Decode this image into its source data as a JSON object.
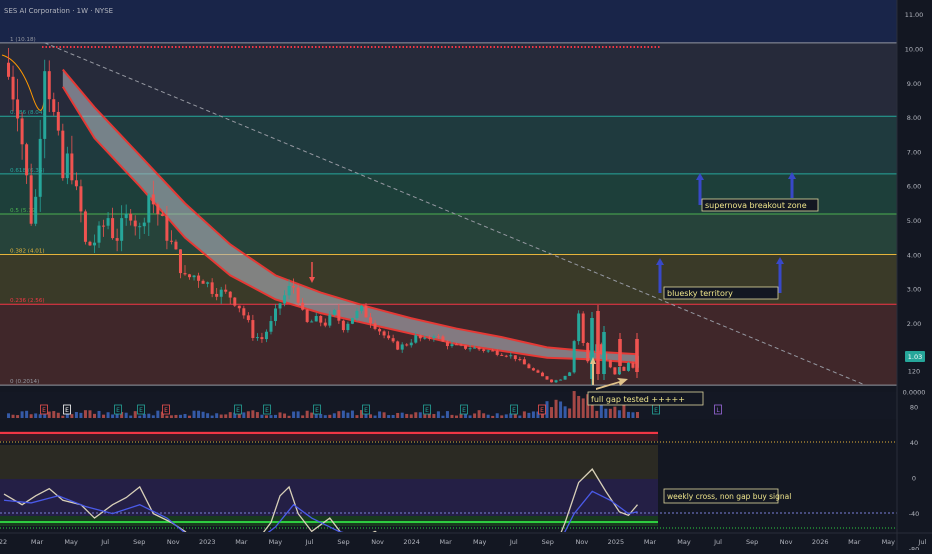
{
  "header": {
    "title": "SES AI Corporation · 1W · NYSE"
  },
  "colors": {
    "background": "#131722",
    "up": "#26a69a",
    "down": "#ef5350",
    "ribbon_edge": "#e53935",
    "ribbon_fill": "#b0b3bd",
    "oscillator_fast": "#d8d0b8",
    "oscillator_slow": "#4a5ae8"
  },
  "annotations": {
    "supernova": "supernova breakout zone",
    "bluesky": "bluesky territory",
    "gap": "full gap tested +++++",
    "cross": "weekly cross, non gap buy signal",
    "last_price": "1.03"
  },
  "chart_data": [
    {
      "type": "candlestick",
      "title": "SES AI Corporation · 1W · NYSE",
      "x_tick_labels": [
        "22",
        "Mar",
        "May",
        "Jul",
        "Sep",
        "Nov",
        "2023",
        "Mar",
        "May",
        "Jul",
        "Sep",
        "Nov",
        "2024",
        "Mar",
        "May",
        "Jul",
        "Sep",
        "Nov",
        "2025",
        "Mar",
        "May",
        "Jul",
        "Sep",
        "Nov",
        "2026",
        "Mar",
        "May",
        "Jul"
      ],
      "y_tick_labels": [
        "11.00",
        "10.00",
        "9.00",
        "8.00",
        "7.00",
        "6.00",
        "5.00",
        "4.00",
        "3.00",
        "2.00",
        "1.00",
        "0.0000"
      ],
      "ylim": [
        0,
        11
      ],
      "fib_levels": [
        {
          "ratio": 1,
          "price": 10.18,
          "label": "1 (10.18)"
        },
        {
          "ratio": 0.786,
          "price": 8.04,
          "label": "0.786 (8.04)"
        },
        {
          "ratio": 0.618,
          "price": 6.36,
          "label": "0.618 (6.36)"
        },
        {
          "ratio": 0.5,
          "price": 5.19,
          "label": "0.5 (5.19)"
        },
        {
          "ratio": 0.382,
          "price": 4.01,
          "label": "0.382 (4.01)"
        },
        {
          "ratio": 0.236,
          "price": 2.56,
          "label": "0.236 (2.56)"
        },
        {
          "ratio": 0,
          "price": 0.2014,
          "label": "0 (0.2014)"
        }
      ],
      "close_path": [
        {
          "t": 0,
          "p": 9.6
        },
        {
          "t": 3,
          "p": 8.4
        },
        {
          "t": 5,
          "p": 6.2
        },
        {
          "t": 6.5,
          "p": 4.5
        },
        {
          "t": 7.5,
          "p": 6.8
        },
        {
          "t": 9,
          "p": 9.8
        },
        {
          "t": 10.5,
          "p": 8.4
        },
        {
          "t": 12,
          "p": 7.2
        },
        {
          "t": 13,
          "p": 6.2
        },
        {
          "t": 14.5,
          "p": 7.0
        },
        {
          "t": 15.5,
          "p": 6.0
        },
        {
          "t": 17,
          "p": 5.2
        },
        {
          "t": 18,
          "p": 4.3
        },
        {
          "t": 19.5,
          "p": 4.3
        },
        {
          "t": 21,
          "p": 4.6
        },
        {
          "t": 23,
          "p": 5.1
        },
        {
          "t": 24.5,
          "p": 4.4
        },
        {
          "t": 26,
          "p": 4.8
        },
        {
          "t": 28,
          "p": 5.3
        },
        {
          "t": 30,
          "p": 4.7
        },
        {
          "t": 32,
          "p": 5.8
        },
        {
          "t": 34,
          "p": 5.2
        },
        {
          "t": 36,
          "p": 4.6
        },
        {
          "t": 38,
          "p": 4.0
        },
        {
          "t": 40,
          "p": 3.3
        },
        {
          "t": 42,
          "p": 3.4
        },
        {
          "t": 44,
          "p": 3.3
        },
        {
          "t": 46,
          "p": 3.0
        },
        {
          "t": 48,
          "p": 2.9
        },
        {
          "t": 50,
          "p": 2.8
        },
        {
          "t": 52,
          "p": 2.5
        },
        {
          "t": 54,
          "p": 2.0
        },
        {
          "t": 55,
          "p": 1.65
        },
        {
          "t": 57,
          "p": 1.55
        },
        {
          "t": 59,
          "p": 2.0
        },
        {
          "t": 61,
          "p": 2.6
        },
        {
          "t": 63,
          "p": 3.0
        },
        {
          "t": 64.5,
          "p": 3.1
        },
        {
          "t": 65.5,
          "p": 2.4
        },
        {
          "t": 67,
          "p": 2.0
        },
        {
          "t": 69,
          "p": 2.1
        },
        {
          "t": 71,
          "p": 2.0
        },
        {
          "t": 73,
          "p": 2.3
        },
        {
          "t": 75,
          "p": 1.9
        },
        {
          "t": 77,
          "p": 2.2
        },
        {
          "t": 79,
          "p": 2.4
        },
        {
          "t": 81,
          "p": 2.1
        },
        {
          "t": 83,
          "p": 1.8
        },
        {
          "t": 85,
          "p": 1.5
        },
        {
          "t": 87,
          "p": 1.3
        },
        {
          "t": 89,
          "p": 1.4
        },
        {
          "t": 91,
          "p": 1.6
        },
        {
          "t": 93,
          "p": 1.5
        },
        {
          "t": 95,
          "p": 1.7
        },
        {
          "t": 97,
          "p": 1.45
        },
        {
          "t": 99,
          "p": 1.35
        },
        {
          "t": 101,
          "p": 1.3
        },
        {
          "t": 103,
          "p": 1.3
        },
        {
          "t": 105,
          "p": 1.25
        },
        {
          "t": 107,
          "p": 1.2
        },
        {
          "t": 109,
          "p": 1.15
        },
        {
          "t": 111,
          "p": 1.1
        },
        {
          "t": 113,
          "p": 1.0
        },
        {
          "t": 115,
          "p": 0.8
        },
        {
          "t": 117,
          "p": 0.62
        },
        {
          "t": 119,
          "p": 0.45
        },
        {
          "t": 121,
          "p": 0.3
        },
        {
          "t": 123,
          "p": 0.38
        },
        {
          "t": 125,
          "p": 0.6
        },
        {
          "t": 126,
          "p": 1.5
        },
        {
          "t": 127,
          "p": 2.3
        },
        {
          "t": 128,
          "p": 1.4
        },
        {
          "t": 129,
          "p": 0.9
        },
        {
          "t": 130,
          "p": 1.2
        },
        {
          "t": 131,
          "p": 1.4
        },
        {
          "t": 132,
          "p": 1.1
        },
        {
          "t": 133,
          "p": 0.9
        },
        {
          "t": 134,
          "p": 0.7
        },
        {
          "t": 135,
          "p": 0.5
        },
        {
          "t": 136,
          "p": 0.75
        },
        {
          "t": 137,
          "p": 0.6
        },
        {
          "t": 138,
          "p": 0.85
        },
        {
          "t": 139,
          "p": 0.75
        },
        {
          "t": 140,
          "p": 1.03
        }
      ],
      "ribbon": [
        {
          "t": 13,
          "upper": 9.4,
          "lower": 8.9
        },
        {
          "t": 20,
          "upper": 8.3,
          "lower": 7.4
        },
        {
          "t": 30,
          "upper": 6.9,
          "lower": 6.0
        },
        {
          "t": 40,
          "upper": 5.5,
          "lower": 4.5
        },
        {
          "t": 50,
          "upper": 4.3,
          "lower": 3.4
        },
        {
          "t": 60,
          "upper": 3.4,
          "lower": 2.7
        },
        {
          "t": 70,
          "upper": 2.9,
          "lower": 2.3
        },
        {
          "t": 80,
          "upper": 2.5,
          "lower": 2.0
        },
        {
          "t": 90,
          "upper": 2.15,
          "lower": 1.7
        },
        {
          "t": 100,
          "upper": 1.85,
          "lower": 1.4
        },
        {
          "t": 110,
          "upper": 1.6,
          "lower": 1.2
        },
        {
          "t": 120,
          "upper": 1.3,
          "lower": 1.0
        },
        {
          "t": 130,
          "upper": 1.18,
          "lower": 0.95
        },
        {
          "t": 140,
          "upper": 1.1,
          "lower": 0.85
        }
      ],
      "trendline": [
        {
          "t": 9,
          "p": 10.18
        },
        {
          "t": 190,
          "p": 0.22
        }
      ],
      "last_price": 1.03
    },
    {
      "type": "line",
      "title": "",
      "y_tick_labels": [
        "120",
        "80",
        "40",
        "0",
        "-40",
        "-80"
      ],
      "ylim": [
        -100,
        125
      ],
      "series": [
        {
          "values": [
            {
              "t": 0,
              "v": -18
            },
            {
              "t": 4,
              "v": -30
            },
            {
              "t": 7,
              "v": -20
            },
            {
              "t": 10,
              "v": -12
            },
            {
              "t": 13,
              "v": -25
            },
            {
              "t": 17,
              "v": -30
            },
            {
              "t": 20,
              "v": -45
            },
            {
              "t": 24,
              "v": -30
            },
            {
              "t": 27,
              "v": -22
            },
            {
              "t": 30,
              "v": -10
            },
            {
              "t": 33,
              "v": -40
            },
            {
              "t": 37,
              "v": -50
            },
            {
              "t": 40,
              "v": -60
            },
            {
              "t": 43,
              "v": -75
            },
            {
              "t": 46,
              "v": -82
            },
            {
              "t": 50,
              "v": -80
            },
            {
              "t": 53,
              "v": -85
            },
            {
              "t": 56,
              "v": -70
            },
            {
              "t": 59,
              "v": -50
            },
            {
              "t": 61,
              "v": -20
            },
            {
              "t": 63,
              "v": -10
            },
            {
              "t": 65,
              "v": -40
            },
            {
              "t": 68,
              "v": -60
            },
            {
              "t": 72,
              "v": -45
            },
            {
              "t": 75,
              "v": -65
            },
            {
              "t": 78,
              "v": -70
            },
            {
              "t": 82,
              "v": -60
            },
            {
              "t": 86,
              "v": -75
            },
            {
              "t": 90,
              "v": -70
            },
            {
              "t": 94,
              "v": -80
            },
            {
              "t": 98,
              "v": -82
            },
            {
              "t": 102,
              "v": -85
            },
            {
              "t": 106,
              "v": -82
            },
            {
              "t": 110,
              "v": -80
            },
            {
              "t": 114,
              "v": -84
            },
            {
              "t": 118,
              "v": -86
            },
            {
              "t": 121,
              "v": -88
            },
            {
              "t": 124,
              "v": -50
            },
            {
              "t": 127,
              "v": -5
            },
            {
              "t": 130,
              "v": 10
            },
            {
              "t": 133,
              "v": -15
            },
            {
              "t": 136,
              "v": -38
            },
            {
              "t": 138,
              "v": -42
            },
            {
              "t": 140,
              "v": -30
            }
          ]
        },
        {
          "values": [
            {
              "t": 0,
              "v": -25
            },
            {
              "t": 6,
              "v": -28
            },
            {
              "t": 12,
              "v": -20
            },
            {
              "t": 18,
              "v": -32
            },
            {
              "t": 24,
              "v": -40
            },
            {
              "t": 30,
              "v": -30
            },
            {
              "t": 36,
              "v": -45
            },
            {
              "t": 42,
              "v": -70
            },
            {
              "t": 48,
              "v": -80
            },
            {
              "t": 54,
              "v": -78
            },
            {
              "t": 60,
              "v": -55
            },
            {
              "t": 64,
              "v": -30
            },
            {
              "t": 68,
              "v": -45
            },
            {
              "t": 74,
              "v": -60
            },
            {
              "t": 80,
              "v": -68
            },
            {
              "t": 86,
              "v": -70
            },
            {
              "t": 92,
              "v": -74
            },
            {
              "t": 98,
              "v": -78
            },
            {
              "t": 104,
              "v": -82
            },
            {
              "t": 110,
              "v": -82
            },
            {
              "t": 116,
              "v": -84
            },
            {
              "t": 122,
              "v": -80
            },
            {
              "t": 126,
              "v": -40
            },
            {
              "t": 130,
              "v": -15
            },
            {
              "t": 134,
              "v": -25
            },
            {
              "t": 138,
              "v": -40
            },
            {
              "t": 140,
              "v": -38
            }
          ]
        }
      ]
    }
  ]
}
